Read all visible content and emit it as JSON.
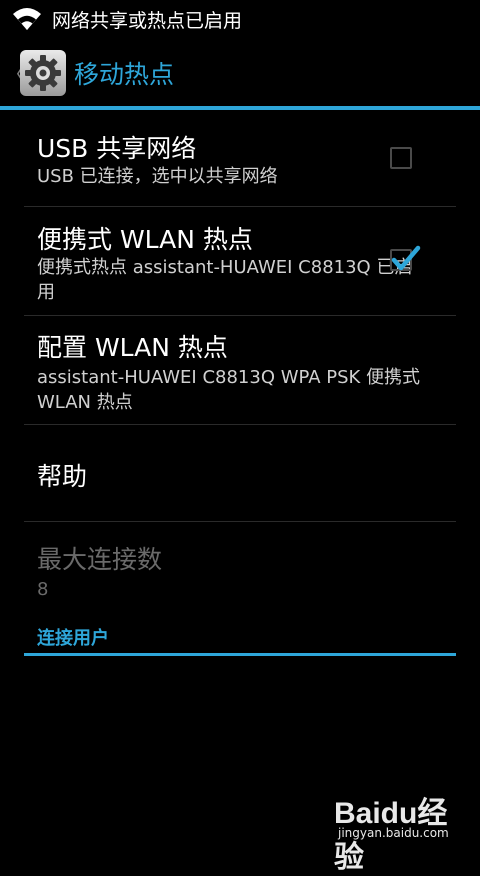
{
  "status_bar": {
    "notification_text": "网络共享或热点已启用",
    "icon": "wifi-hotspot-icon"
  },
  "action_bar": {
    "title": "移动热点",
    "back_icon": "chevron-left-icon",
    "app_icon": "settings-gear-icon",
    "accent_color": "#2ea6d9"
  },
  "preferences": [
    {
      "title": "USB 共享网络",
      "summary": "USB 已连接，选中以共享网络",
      "checked": false
    },
    {
      "title": "便携式 WLAN 热点",
      "summary": "便携式热点 assistant-HUAWEI C8813Q 已启用",
      "checked": true
    },
    {
      "title": "配置 WLAN 热点",
      "summary": "assistant-HUAWEI C8813Q WPA PSK 便携式 WLAN 热点"
    },
    {
      "title": "帮助"
    },
    {
      "title": "最大连接数",
      "summary": "8",
      "enabled": false
    }
  ],
  "category": {
    "title": "连接用户"
  },
  "watermark": {
    "logo_text": "Baidu经验",
    "url": "jingyan.baidu.com"
  }
}
